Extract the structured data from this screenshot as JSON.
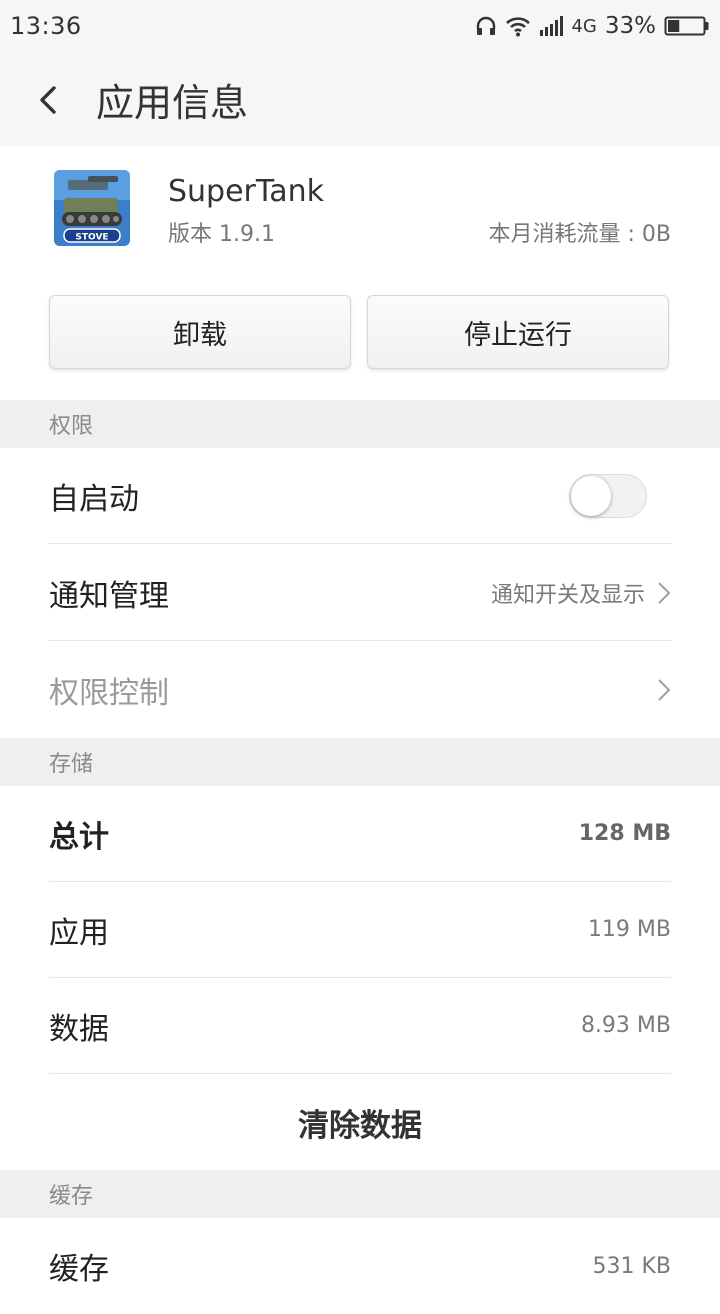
{
  "status_bar": {
    "time": "13:36",
    "network": "4G",
    "battery_percent": "33%",
    "battery_level": 0.33,
    "icons": [
      "headphones-icon",
      "wifi-icon",
      "signal-icon",
      "battery-icon"
    ]
  },
  "header": {
    "title": "应用信息",
    "back_icon": "back-arrow-icon"
  },
  "app": {
    "name": "SuperTank",
    "version": "版本 1.9.1",
    "data_usage": "本月消耗流量 : 0B",
    "icon_badge": "STOVE"
  },
  "actions": {
    "uninstall_label": "卸载",
    "stop_label": "停止运行"
  },
  "permissions": {
    "section_title": "权限",
    "autostart": {
      "label": "自启动",
      "enabled": false
    },
    "notification": {
      "label": "通知管理",
      "value": "通知开关及显示"
    },
    "permission_control": {
      "label": "权限控制"
    }
  },
  "storage": {
    "section_title": "存储",
    "total": {
      "label": "总计",
      "value": "128 MB"
    },
    "app": {
      "label": "应用",
      "value": "119 MB"
    },
    "data": {
      "label": "数据",
      "value": "8.93 MB"
    },
    "clear_label": "清除数据"
  },
  "cache": {
    "section_title": "缓存",
    "item": {
      "label": "缓存",
      "value": "531 KB"
    }
  },
  "colors": {
    "background": "#ffffff",
    "section_bg": "#efefef",
    "app_icon_bg": "#3b7fcb"
  }
}
